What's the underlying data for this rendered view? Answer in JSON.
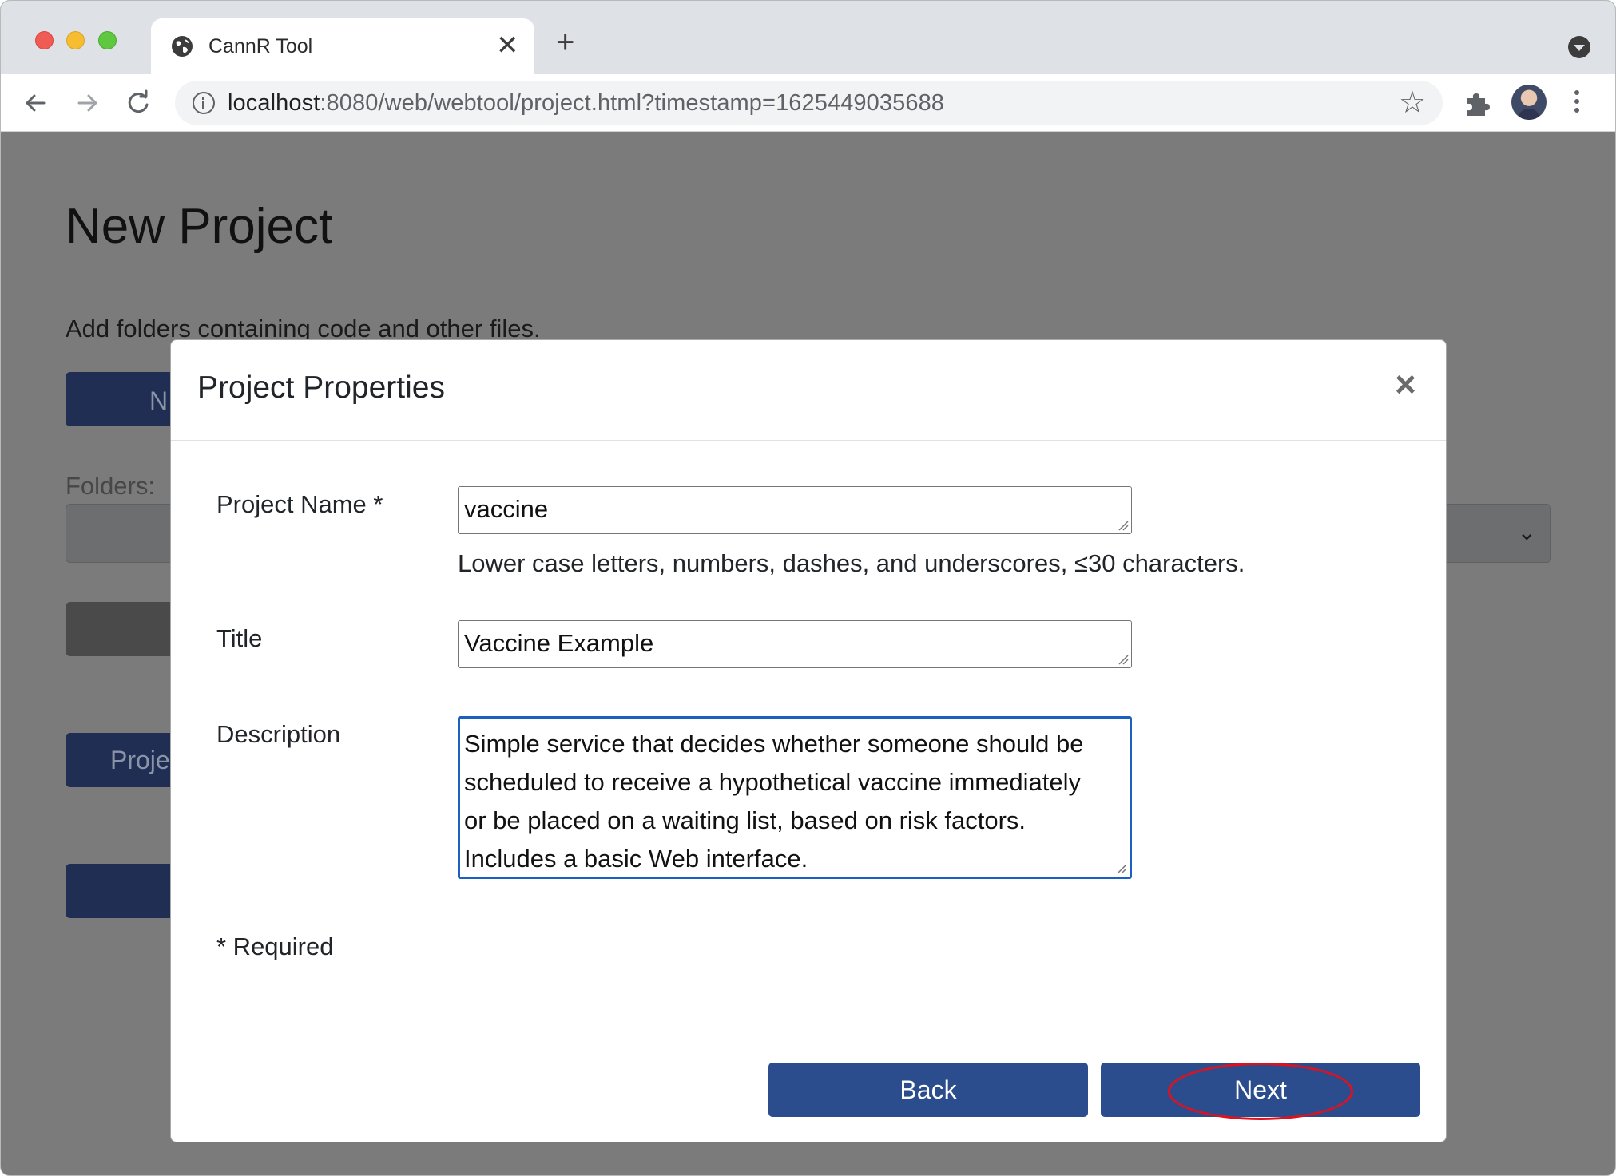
{
  "browser": {
    "tab_title": "CannR Tool",
    "tab_close": "✕",
    "new_tab": "+",
    "url_host": "localhost",
    "url_rest": ":8080/web/webtool/project.html?timestamp=1625449035688"
  },
  "page": {
    "title": "New Project",
    "subtitle": "Add folders containing code and other files.",
    "folders_label": "Folders:",
    "bg_button_1": "N",
    "bg_button_3": "Proje"
  },
  "modal": {
    "title": "Project Properties",
    "close": "×",
    "fields": {
      "project_name_label": "Project Name *",
      "project_name_value": "vaccine",
      "project_name_help": "Lower case letters, numbers, dashes, and underscores, ≤30 characters.",
      "title_label": "Title",
      "title_value": "Vaccine Example",
      "description_label": "Description",
      "description_lines": [
        "Simple service that decides whether someone should be",
        "scheduled to receive a hypothetical vaccine immediately",
        "or be placed on a waiting list, based on risk factors.",
        "Includes a basic Web interface."
      ]
    },
    "required_note": "* Required",
    "buttons": {
      "back": "Back",
      "next": "Next"
    }
  },
  "colors": {
    "primary_button": "#2c4d8d",
    "focus_border": "#1b5fc1",
    "highlight": "#e0111d",
    "backdrop": "#7b7b7b"
  }
}
